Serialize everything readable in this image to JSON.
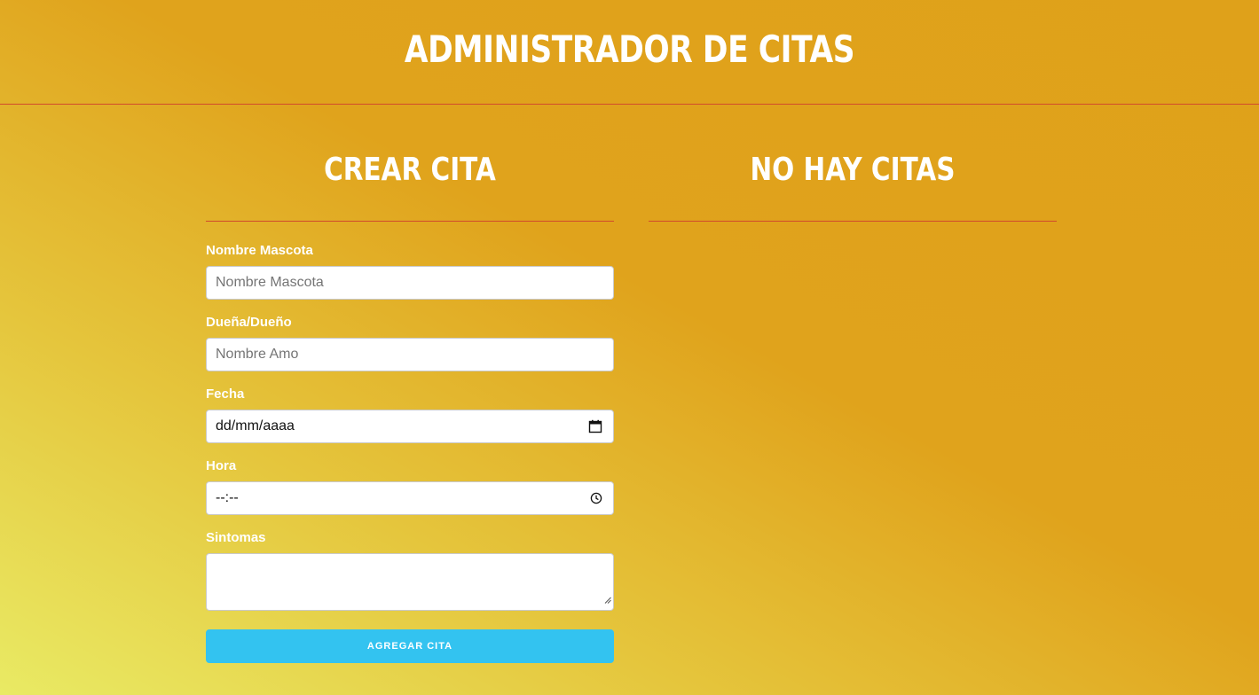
{
  "header": {
    "title": "ADMINISTRADOR DE CITAS"
  },
  "create_section": {
    "title": "CREAR CITA"
  },
  "list_section": {
    "title": "NO HAY CITAS"
  },
  "form": {
    "pet_name": {
      "label": "Nombre Mascota",
      "placeholder": "Nombre Mascota"
    },
    "owner": {
      "label": "Dueña/Dueño",
      "placeholder": "Nombre Amo"
    },
    "date": {
      "label": "Fecha",
      "value": "dd/mm/aaaa",
      "icon": "calendar-icon"
    },
    "time": {
      "label": "Hora",
      "value": "--:--",
      "icon": "clock-icon"
    },
    "symptoms": {
      "label": "Sintomas",
      "value": ""
    },
    "submit_label": "AGREGAR CITA"
  },
  "colors": {
    "accent_line": "#d14a2c",
    "button": "#33c3f0",
    "background_start": "#e9ea64",
    "background_end": "#dfa11a"
  }
}
